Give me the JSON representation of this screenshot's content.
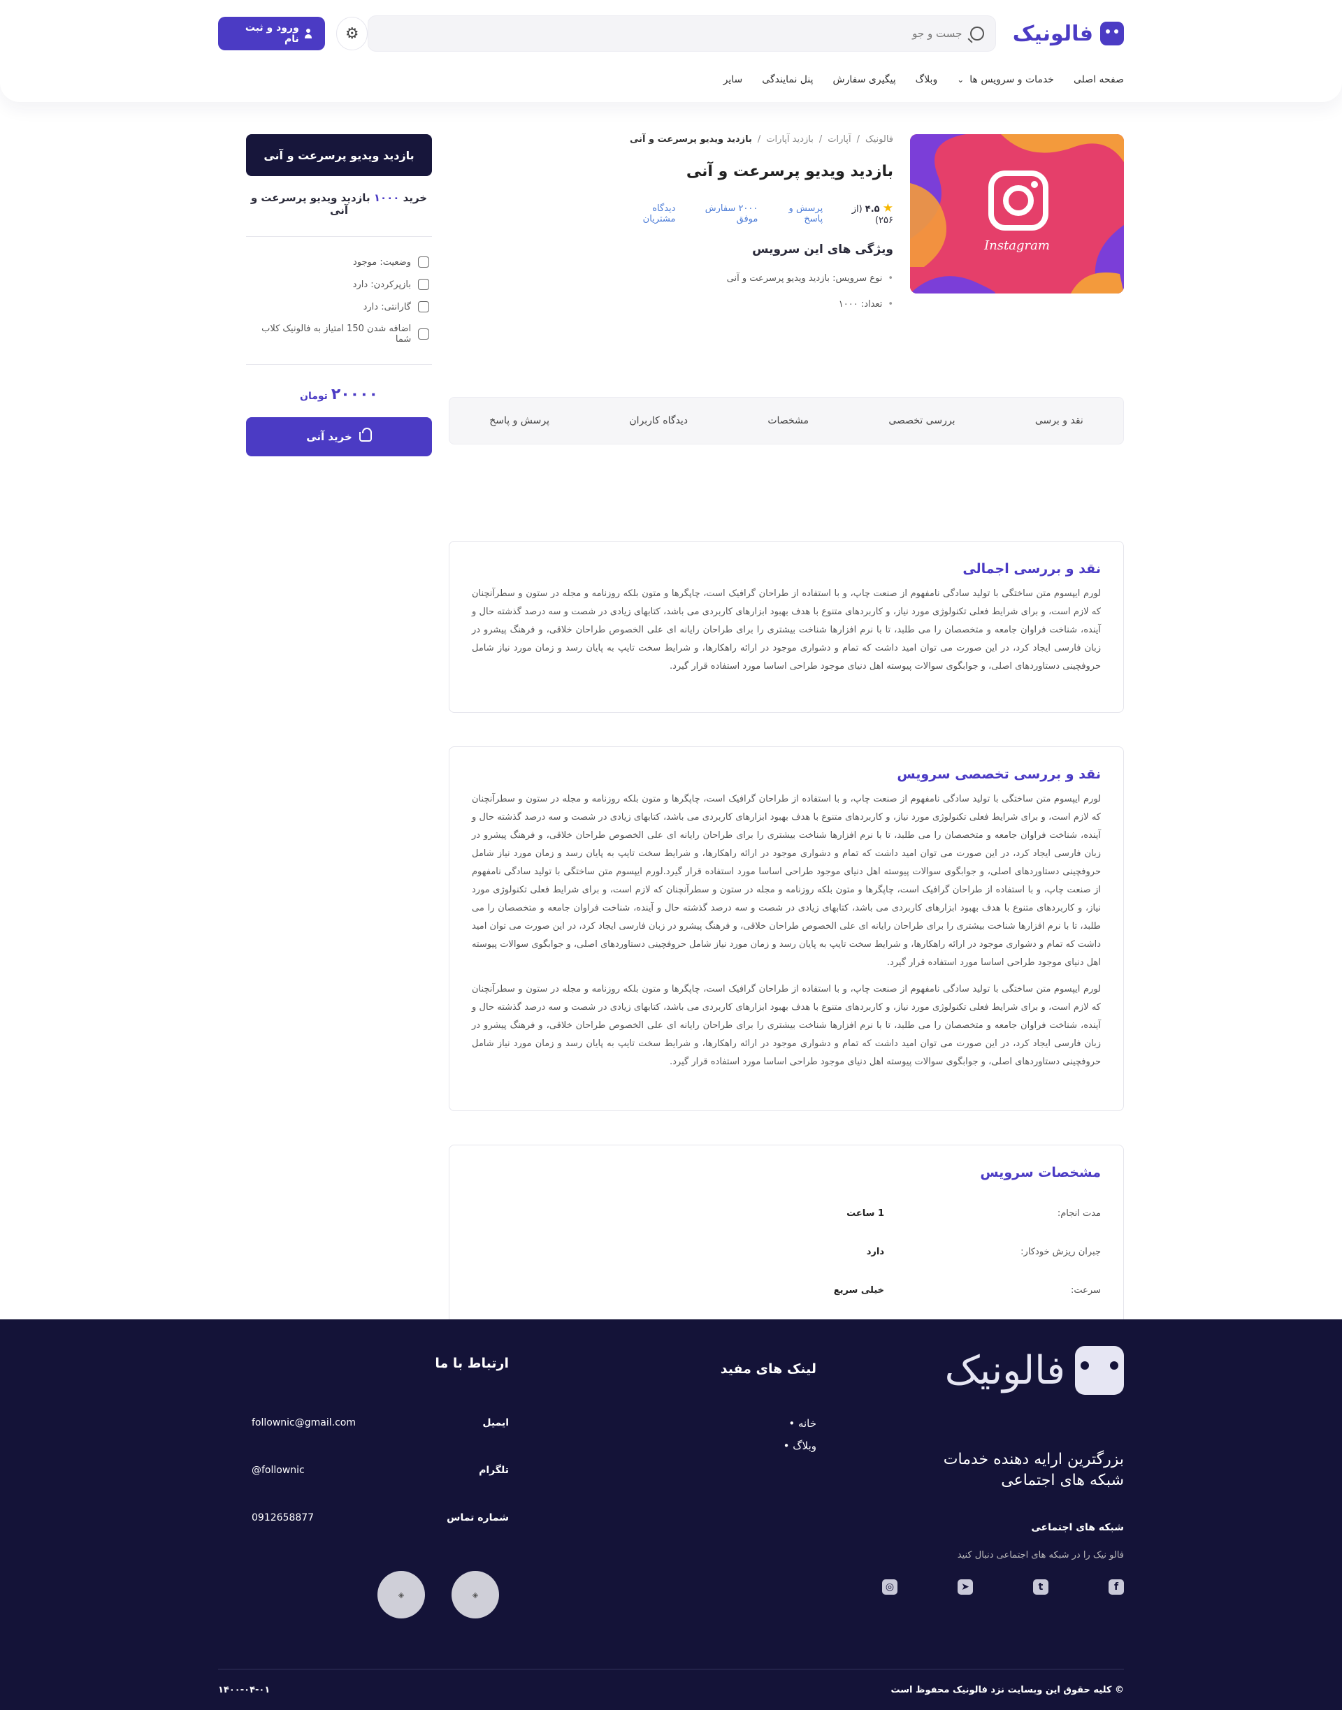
{
  "header": {
    "logo_text": "فالونیک",
    "search_placeholder": "جست و جو",
    "login_label": "ورود و ثبت نام",
    "nav": [
      "صفحه اصلی",
      "خدمات و سرویس ها",
      "وبلاگ",
      "پیگیری سفارش",
      "پنل نمایندگی",
      "سایر"
    ]
  },
  "product": {
    "image_label": "Instagram",
    "breadcrumb": [
      "فالونیک",
      "آپارات",
      "بازدید آپارات",
      "بازدید ویدیو پرسرعت و آنی"
    ],
    "title": "بازدید ویدیو پرسرعت و آنی",
    "rating": "۴.۵",
    "rating_count": "(از ۲۵۶)",
    "qa_link": "پرسش و پاسخ",
    "orders_link": "۲۰۰۰ سفارش موفق",
    "reviews_link": "دیدگاه مشتریان",
    "features_title": "ویژگی های این سرویس",
    "features": [
      "نوع سرویس: بازدید ویدیو پرسرعت و آنی",
      "تعداد: ۱۰۰۰"
    ]
  },
  "tabs": [
    "نقد و برسی",
    "بررسی تخصصی",
    "مشخصات",
    "دیدگاه کاربران",
    "پرسش و پاسخ"
  ],
  "sidebar": {
    "title": "بازدید ویدیو پرسرعت و آنی",
    "buy_prefix": "خرید",
    "buy_num": "۱۰۰۰",
    "buy_suffix": "بازدید ویدیو پرسرعت و آنی",
    "status": "وضعیت: موجود",
    "refund": "بازپرکردن: دارد",
    "warranty": "گارانتی: دارد",
    "points": "اضافه شدن 150 امتیاز به فالونیک کلاب شما",
    "price": "۲۰۰۰۰",
    "currency": "تومان",
    "buy_button": "خرید آنی"
  },
  "review": {
    "title": "نقد و بررسی اجمالی",
    "text": "لورم ایپسوم متن ساختگی با تولید سادگی نامفهوم از صنعت چاپ، و با استفاده از طراحان گرافیک است، چاپگرها و متون بلکه روزنامه و مجله در ستون و سطرآنچنان که لازم است، و برای شرایط فعلی تکنولوژی مورد نیاز، و کاربردهای متنوع با هدف بهبود ابزارهای کاربردی می باشد، کتابهای زیادی در شصت و سه درصد گذشته حال و آینده، شناخت فراوان جامعه و متخصصان را می طلبد، تا با نرم افزارها شناخت بیشتری را برای طراحان رایانه ای علی الخصوص طراحان خلاقی، و فرهنگ پیشرو در زبان فارسی ایجاد کرد، در این صورت می توان امید داشت که تمام و دشواری موجود در ارائه راهکارها، و شرایط سخت تایپ به پایان رسد و زمان مورد نیاز شامل حروفچینی دستاوردهای اصلی، و جوابگوی سوالات پیوسته اهل دنیای موجود طراحی اساسا مورد استفاده قرار گیرد."
  },
  "expert": {
    "title": "نقد و بررسی تخصصی سرویس",
    "text1": "لورم ایپسوم متن ساختگی با تولید سادگی نامفهوم از صنعت چاپ، و با استفاده از طراحان گرافیک است، چاپگرها و متون بلکه روزنامه و مجله در ستون و سطرآنچنان که لازم است، و برای شرایط فعلی تکنولوژی مورد نیاز، و کاربردهای متنوع با هدف بهبود ابزارهای کاربردی می باشد، کتابهای زیادی در شصت و سه درصد گذشته حال و آینده، شناخت فراوان جامعه و متخصصان را می طلبد، تا با نرم افزارها شناخت بیشتری را برای طراحان رایانه ای علی الخصوص طراحان خلاقی، و فرهنگ پیشرو در زبان فارسی ایجاد کرد، در این صورت می توان امید داشت که تمام و دشواری موجود در ارائه راهکارها، و شرایط سخت تایپ به پایان رسد و زمان مورد نیاز شامل حروفچینی دستاوردهای اصلی، و جوابگوی سوالات پیوسته اهل دنیای موجود طراحی اساسا مورد استفاده قرار گیرد.لورم ایپسوم متن ساختگی با تولید سادگی نامفهوم از صنعت چاپ، و با استفاده از طراحان گرافیک است، چاپگرها و متون بلکه روزنامه و مجله در ستون و سطرآنچنان که لازم است، و برای شرایط فعلی تکنولوژی مورد نیاز، و کاربردهای متنوع با هدف بهبود ابزارهای کاربردی می باشد، کتابهای زیادی در شصت و سه درصد گذشته حال و آینده، شناخت فراوان جامعه و متخصصان را می طلبد، تا با نرم افزارها شناخت بیشتری را برای طراحان رایانه ای علی الخصوص طراحان خلاقی، و فرهنگ پیشرو در زبان فارسی ایجاد کرد، در این صورت می توان امید داشت که تمام و دشواری موجود در ارائه راهکارها، و شرایط سخت تایپ به پایان رسد و زمان مورد نیاز شامل حروفچینی دستاوردهای اصلی، و جوابگوی سوالات پیوسته اهل دنیای موجود طراحی اساسا مورد استفاده قرار گیرد.",
    "text2": "لورم ایپسوم متن ساختگی با تولید سادگی نامفهوم از صنعت چاپ، و با استفاده از طراحان گرافیک است، چاپگرها و متون بلکه روزنامه و مجله در ستون و سطرآنچنان که لازم است، و برای شرایط فعلی تکنولوژی مورد نیاز، و کاربردهای متنوع با هدف بهبود ابزارهای کاربردی می باشد، کتابهای زیادی در شصت و سه درصد گذشته حال و آینده، شناخت فراوان جامعه و متخصصان را می طلبد، تا با نرم افزارها شناخت بیشتری را برای طراحان رایانه ای علی الخصوص طراحان خلاقی، و فرهنگ پیشرو در زبان فارسی ایجاد کرد، در این صورت می توان امید داشت که تمام و دشواری موجود در ارائه راهکارها، و شرایط سخت تایپ به پایان رسد و زمان مورد نیاز شامل حروفچینی دستاوردهای اصلی، و جوابگوی سوالات پیوسته اهل دنیای موجود طراحی اساسا مورد استفاده قرار گیرد."
  },
  "specs": {
    "title": "مشخصات سرویس",
    "rows": [
      {
        "label": "مدت انجام:",
        "value": "1 ساعت"
      },
      {
        "label": "جبران ریزش خودکار:",
        "value": "دارد"
      },
      {
        "label": "سرعت:",
        "value": "خیلی سریع"
      }
    ]
  },
  "footer": {
    "logo_text": "فالونیک",
    "slogan": "بزرگترین ارایه دهنده خدمات شبکه های اجتماعی",
    "social_title": "شبکه های اجتماعی",
    "social_text": "فالو نیک را در شبکه های اجتماعی دنبال کنید",
    "links_title": "لینک های مفید",
    "links": [
      "خانه",
      "وبلاگ"
    ],
    "contact_title": "ارتباط با ما",
    "email_label": "ایمیل",
    "email": "follownic@gmail.com",
    "telegram_label": "تلگرام",
    "telegram": "follownic@",
    "phone_label": "شماره تماس",
    "phone": "0912658877",
    "copyright": "کلیه حقوق این وبسایت نزد فالونیک محفوظ است",
    "date": "۱۴۰۰-۰۴-۰۱"
  },
  "colors": {
    "brand": "#4b3bc4",
    "footer_bg": "#141338",
    "link": "#4b7bd6"
  }
}
